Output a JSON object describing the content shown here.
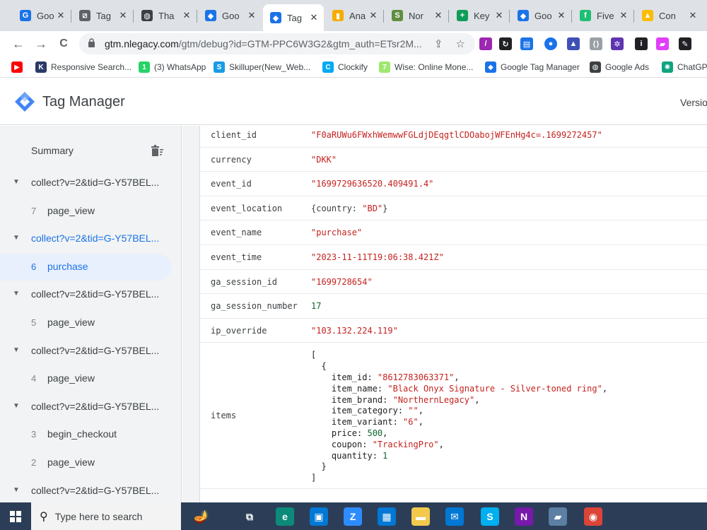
{
  "tabs": [
    {
      "title": "Goo",
      "fav": "G",
      "fav_color": "#1a73e8",
      "icon": "gtm-diamond-icon"
    },
    {
      "title": "Tag",
      "fav": "⧄",
      "fav_color": "#5f6368",
      "icon": "tag-assistant-icon"
    },
    {
      "title": "Tha",
      "fav": "◍",
      "fav_color": "#3c4043",
      "icon": "globe-icon"
    },
    {
      "title": "Goo",
      "fav": "◆",
      "fav_color": "#1a73e8",
      "icon": "gtm-diamond-icon"
    },
    {
      "title": "Tag",
      "fav": "◆",
      "fav_color": "#1a73e8",
      "icon": "gtm-diamond-icon",
      "active": true
    },
    {
      "title": "Ana",
      "fav": "▮",
      "fav_color": "#f9ab00",
      "icon": "analytics-icon"
    },
    {
      "title": "Nor",
      "fav": "S",
      "fav_color": "#5e8e3e",
      "icon": "shopify-icon"
    },
    {
      "title": "Key",
      "fav": "+",
      "fav_color": "#0f9d58",
      "icon": "sheets-icon"
    },
    {
      "title": "Goo",
      "fav": "◆",
      "fav_color": "#1a73e8",
      "icon": "gtm-diamond-icon"
    },
    {
      "title": "Five",
      "fav": "f",
      "fav_color": "#1dbf73",
      "icon": "fiverr-icon"
    },
    {
      "title": "Con",
      "fav": "▲",
      "fav_color": "#fbbc04",
      "icon": "google-ads-icon"
    }
  ],
  "toolbar": {
    "back": "←",
    "forward": "→",
    "reload": "C",
    "url_host": "gtm.nlegacy.com",
    "url_rest": "/gtm/debug?id=GTM-PPC6W3G2&gtm_auth=ETsr2M...",
    "share": "⇪",
    "star": "☆"
  },
  "bookmarks": [
    {
      "label": "",
      "fav": "▶",
      "fav_color": "#ff0000",
      "icon": "youtube-icon"
    },
    {
      "label": "Responsive Search...",
      "fav": "K",
      "fav_color": "#2b3a67",
      "icon": "k-icon"
    },
    {
      "label": "(3) WhatsApp",
      "fav": "1",
      "fav_color": "#25d366",
      "icon": "whatsapp-icon"
    },
    {
      "label": "Skilluper(New_Web...",
      "fav": "S",
      "fav_color": "#1a9be6",
      "icon": "skilluper-icon"
    },
    {
      "label": "Clockify",
      "fav": "C",
      "fav_color": "#03a9f4",
      "icon": "clockify-icon"
    },
    {
      "label": "Wise: Online Mone...",
      "fav": "7",
      "fav_color": "#9fe870",
      "icon": "wise-icon"
    },
    {
      "label": "Google Tag Manager",
      "fav": "◆",
      "fav_color": "#1a73e8",
      "icon": "gtm-diamond-icon"
    },
    {
      "label": "Google Ads",
      "fav": "◍",
      "fav_color": "#3c4043",
      "icon": "globe-icon"
    },
    {
      "label": "ChatGPT",
      "fav": "✺",
      "fav_color": "#10a37f",
      "icon": "chatgpt-icon"
    }
  ],
  "header": {
    "title": "Tag Manager",
    "version_label": "Versio"
  },
  "sidebar": {
    "summary": "Summary",
    "items": [
      {
        "kind": "req",
        "label": "collect?v=2&tid=G-Y57BEL...",
        "active": false
      },
      {
        "kind": "event",
        "num": "7",
        "label": "page_view"
      },
      {
        "kind": "req",
        "label": "collect?v=2&tid=G-Y57BEL...",
        "active": true
      },
      {
        "kind": "event",
        "num": "6",
        "label": "purchase",
        "selected": true
      },
      {
        "kind": "req",
        "label": "collect?v=2&tid=G-Y57BEL...",
        "active": false
      },
      {
        "kind": "event",
        "num": "5",
        "label": "page_view"
      },
      {
        "kind": "req",
        "label": "collect?v=2&tid=G-Y57BEL...",
        "active": false
      },
      {
        "kind": "event",
        "num": "4",
        "label": "page_view"
      },
      {
        "kind": "req",
        "label": "collect?v=2&tid=G-Y57BEL...",
        "active": false
      },
      {
        "kind": "event",
        "num": "3",
        "label": "begin_checkout"
      },
      {
        "kind": "event",
        "num": "2",
        "label": "page_view"
      },
      {
        "kind": "req",
        "label": "collect?v=2&tid=G-Y57BEL...",
        "active": false
      }
    ]
  },
  "params": [
    {
      "key": "client_id",
      "value": "\"F0aRUWu6FWxhWemwwFGLdjDEqgtlCDOabojWFEnHg4c=.1699272457\"",
      "type": "str"
    },
    {
      "key": "currency",
      "value": "\"DKK\"",
      "type": "str"
    },
    {
      "key": "event_id",
      "value": "\"1699729636520.409491.4\"",
      "type": "str"
    },
    {
      "key": "event_location",
      "value": "{country: \"BD\"}",
      "type": "obj"
    },
    {
      "key": "event_name",
      "value": "\"purchase\"",
      "type": "str"
    },
    {
      "key": "event_time",
      "value": "\"2023-11-11T19:06:38.421Z\"",
      "type": "str"
    },
    {
      "key": "ga_session_id",
      "value": "\"1699728654\"",
      "type": "str"
    },
    {
      "key": "ga_session_number",
      "value": "17",
      "type": "num"
    },
    {
      "key": "ip_override",
      "value": "\"103.132.224.119\"",
      "type": "str"
    }
  ],
  "items_param": {
    "key": "items",
    "lines": [
      "[",
      "  {",
      "    item_id: \"8612783063371\",",
      "    item_name: \"Black Onyx Signature - Silver-toned ring\",",
      "    item_brand: \"NorthernLegacy\",",
      "    item_category: \"\",",
      "    item_variant: \"6\",",
      "    price: 500,",
      "    coupon: \"TrackingPro\",",
      "    quantity: 1",
      "  }",
      "]"
    ]
  },
  "taskbar": {
    "search_placeholder": "Type here to search",
    "apps": [
      {
        "icon": "task-view-icon",
        "glyph": "⧉",
        "color": "#2c3e57"
      },
      {
        "icon": "edge-icon",
        "glyph": "e",
        "color": "#0c8a7a"
      },
      {
        "icon": "store-icon",
        "glyph": "▣",
        "color": "#0078d4"
      },
      {
        "icon": "zoom-icon",
        "glyph": "Z",
        "color": "#2d8cff"
      },
      {
        "icon": "calendar-app-icon",
        "glyph": "▦",
        "color": "#0078d4"
      },
      {
        "icon": "file-explorer-icon",
        "glyph": "▬",
        "color": "#f2c94c"
      },
      {
        "icon": "mail-icon",
        "glyph": "✉",
        "color": "#0078d4"
      },
      {
        "icon": "skype-icon",
        "glyph": "S",
        "color": "#00aff0"
      },
      {
        "icon": "onenote-icon",
        "glyph": "N",
        "color": "#7719aa"
      },
      {
        "icon": "notes-icon",
        "glyph": "▰",
        "color": "#5c7fa3"
      },
      {
        "icon": "chrome-icon",
        "glyph": "◉",
        "color": "#db4437"
      }
    ]
  }
}
